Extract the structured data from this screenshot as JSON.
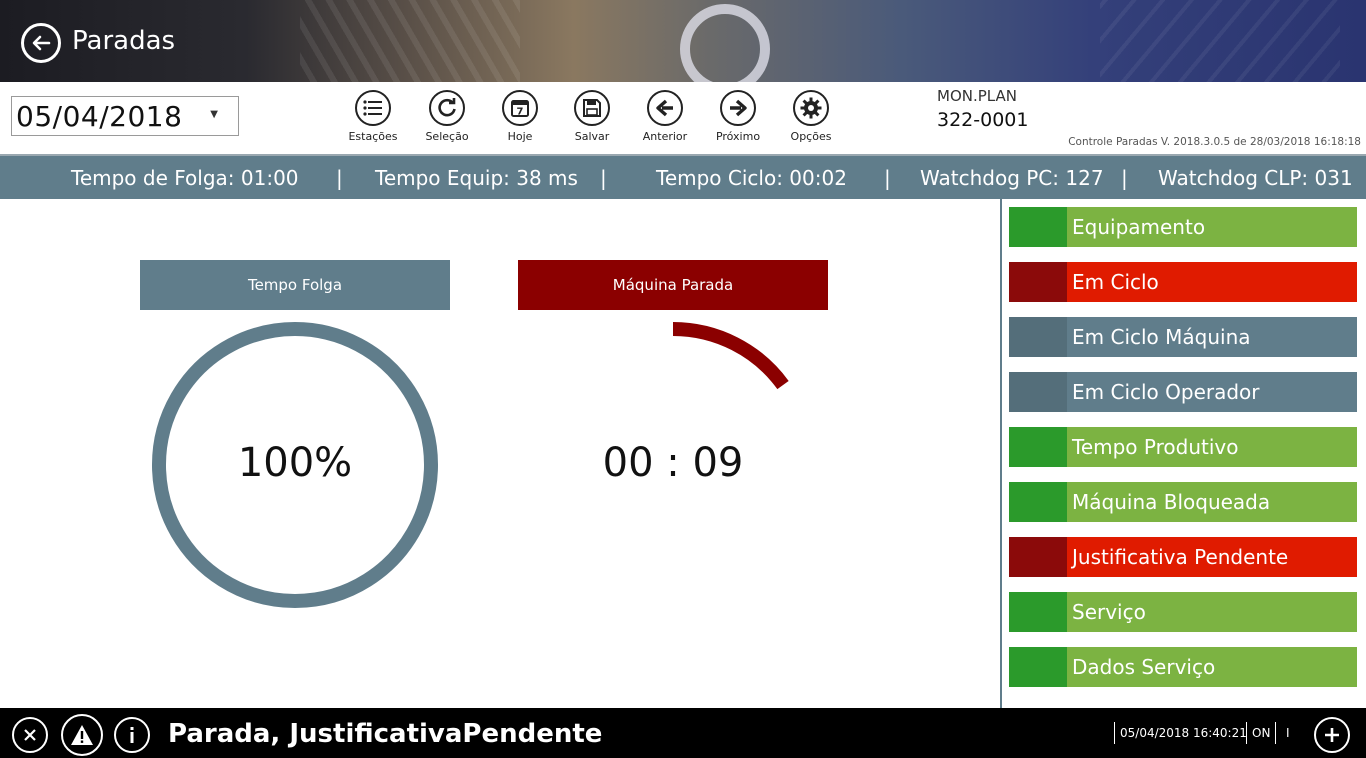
{
  "header": {
    "title": "Paradas"
  },
  "toolbar": {
    "date": "05/04/2018",
    "buttons": [
      {
        "label": "Estações",
        "icon": "list-icon"
      },
      {
        "label": "Seleção",
        "icon": "refresh-icon"
      },
      {
        "label": "Hoje",
        "icon": "calendar-icon",
        "icon_text": "7"
      },
      {
        "label": "Salvar",
        "icon": "save-icon"
      },
      {
        "label": "Anterior",
        "icon": "arrow-left-icon"
      },
      {
        "label": "Próximo",
        "icon": "arrow-right-icon"
      },
      {
        "label": "Opções",
        "icon": "gear-icon"
      }
    ],
    "station_name": "MON.PLAN",
    "station_code": "322-0001",
    "version": "Controle Paradas V. 2018.3.0.5 de 28/03/2018 16:18:18"
  },
  "status": {
    "tempo_folga": "Tempo de Folga: 01:00",
    "tempo_equip": "Tempo Equip: 38 ms",
    "tempo_ciclo": "Tempo Ciclo: 00:02",
    "watchdog_pc": "Watchdog PC: 127",
    "watchdog_clp": "Watchdog CLP: 031",
    "separator": "|"
  },
  "gauges": [
    {
      "title": "Tempo Folga",
      "value": "100%",
      "fraction": 1.0,
      "color": "#607d8b"
    },
    {
      "title": "Máquina Parada",
      "value": "00 : 09",
      "fraction": 0.15,
      "color": "#8b0000"
    }
  ],
  "side_panel": [
    {
      "label": "Equipamento",
      "swatch": "#2b9a2b",
      "bg": "#7cb342"
    },
    {
      "label": "Em Ciclo",
      "swatch": "#8b0a0a",
      "bg": "#e01b00"
    },
    {
      "label": "Em Ciclo Máquina",
      "swatch": "#546e7a",
      "bg": "#607d8b"
    },
    {
      "label": "Em Ciclo Operador",
      "swatch": "#546e7a",
      "bg": "#607d8b"
    },
    {
      "label": "Tempo Produtivo",
      "swatch": "#2b9a2b",
      "bg": "#7cb342"
    },
    {
      "label": "Máquina Bloqueada",
      "swatch": "#2b9a2b",
      "bg": "#7cb342"
    },
    {
      "label": "Justificativa Pendente",
      "swatch": "#8b0a0a",
      "bg": "#e01b00"
    },
    {
      "label": "Serviço",
      "swatch": "#2b9a2b",
      "bg": "#7cb342"
    },
    {
      "label": "Dados Serviço",
      "swatch": "#2b9a2b",
      "bg": "#7cb342"
    }
  ],
  "bottom": {
    "message": "Parada, JustificativaPendente",
    "datetime": "05/04/2018 16:40:21",
    "state": "ON",
    "marker": "I"
  }
}
